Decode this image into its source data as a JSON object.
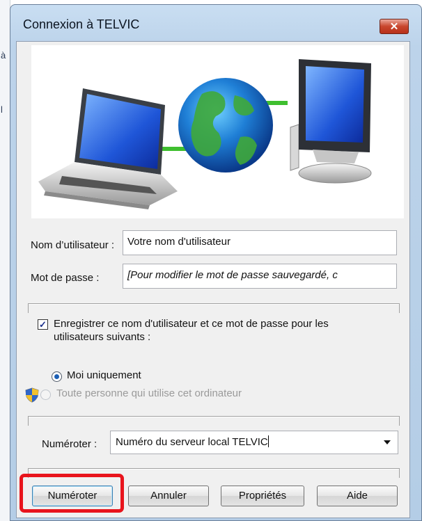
{
  "window": {
    "title": "Connexion à TELVIC",
    "close_label": "✕"
  },
  "form": {
    "username_label": "Nom d’utilisateur :",
    "username_value": "Votre nom d'utilisateur",
    "password_label": "Mot de passe :",
    "password_value": "[Pour modifier le mot de passe sauvegardé, c",
    "save_checkbox_checked": true,
    "save_checkbox_label_line1": "Enregistrer ce nom d'utilisateur et ce mot de passe pour les",
    "save_checkbox_label_line2": "utilisateurs suivants :",
    "radio_me_label": "Moi uniquement",
    "radio_me_selected": true,
    "radio_anyone_label": "Toute personne qui utilise cet ordinateur",
    "radio_anyone_enabled": false,
    "dial_label": "Numéroter :",
    "dial_value": "Numéro du serveur local TELVIC"
  },
  "buttons": {
    "dial": "Numéroter",
    "cancel": "Annuler",
    "properties": "Propriétés",
    "help": "Aide"
  },
  "background_fragments": {
    "glyph_a": "à",
    "glyph_pipe": "l"
  },
  "colors": {
    "highlight_border": "#e8141c",
    "dialog_frame": "#b4cde6",
    "close_button": "#c8462d"
  },
  "icons": {
    "banner": "laptop-globe-computer-network",
    "uac": "uac-shield-icon",
    "dropdown": "chevron-down-icon"
  }
}
